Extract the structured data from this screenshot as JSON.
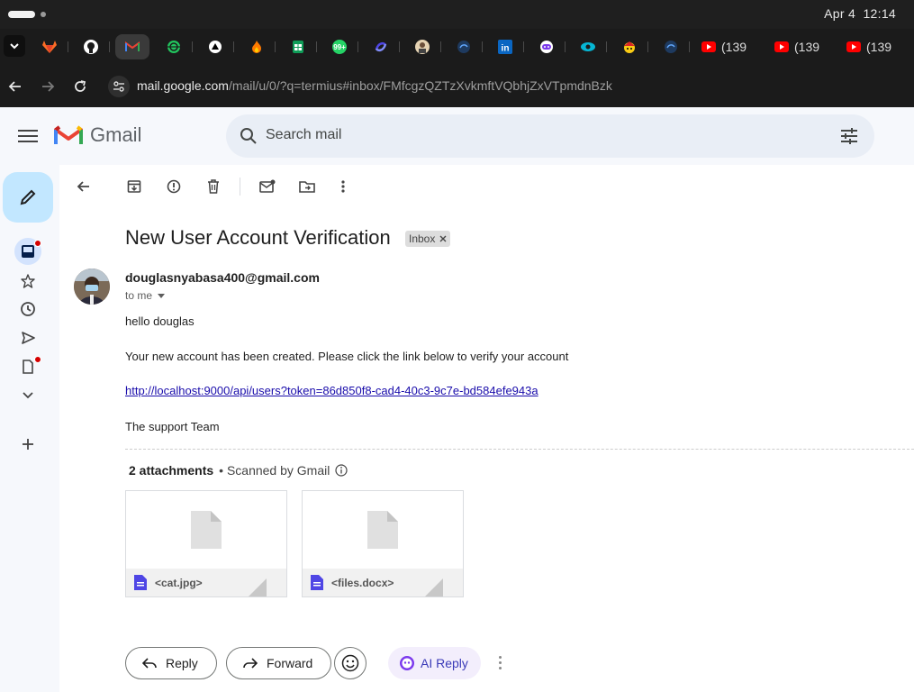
{
  "system": {
    "date": "Apr 4",
    "time": "12:14"
  },
  "tabs": {
    "pinned": [
      "gitlab-icon",
      "github-icon",
      "gmail-icon",
      "green-globe-icon",
      "triangle-icon",
      "fire-icon",
      "sheets-icon",
      "whatsapp-icon",
      "swirl-icon",
      "avatar-icon",
      "devtools-icon",
      "linkedin-icon",
      "chat-icon",
      "eye-icon",
      "hat-icon",
      "devtools-icon"
    ],
    "youtube": [
      {
        "label": "(139"
      },
      {
        "label": "(139"
      },
      {
        "label": "(139"
      }
    ]
  },
  "browser": {
    "url_host": "mail.google.com",
    "url_path": "/mail/u/0/?q=termius#inbox/FMfcgzQZTzXvkmftVQbhjZxVTpmdnBzk"
  },
  "gmail": {
    "logo_text": "Gmail",
    "search_placeholder": "Search mail"
  },
  "email": {
    "subject": "New User Account Verification",
    "label_chip": "Inbox",
    "sender": "douglasnyabasa400@gmail.com",
    "recipient_line": "to me",
    "body": {
      "greeting": "hello douglas",
      "message": "Your new account has been created. Please click the link below to verify your account",
      "link": "http://localhost:9000/api/users?token=86d850f8-cad4-40c3-9c7e-bd584efe943a",
      "signoff": "The support Team"
    },
    "attachments_count_label": "2 attachments",
    "scanned_label": "• Scanned by Gmail",
    "attachments": [
      {
        "name": "<cat.jpg>"
      },
      {
        "name": "<files.docx>"
      }
    ]
  },
  "actions": {
    "reply": "Reply",
    "forward": "Forward",
    "ai_reply": "AI Reply"
  },
  "colors": {
    "compose_bg": "#c2e7ff",
    "search_bg": "#e9eef6",
    "link": "#1a0dab",
    "unread_dot": "#d50000"
  }
}
